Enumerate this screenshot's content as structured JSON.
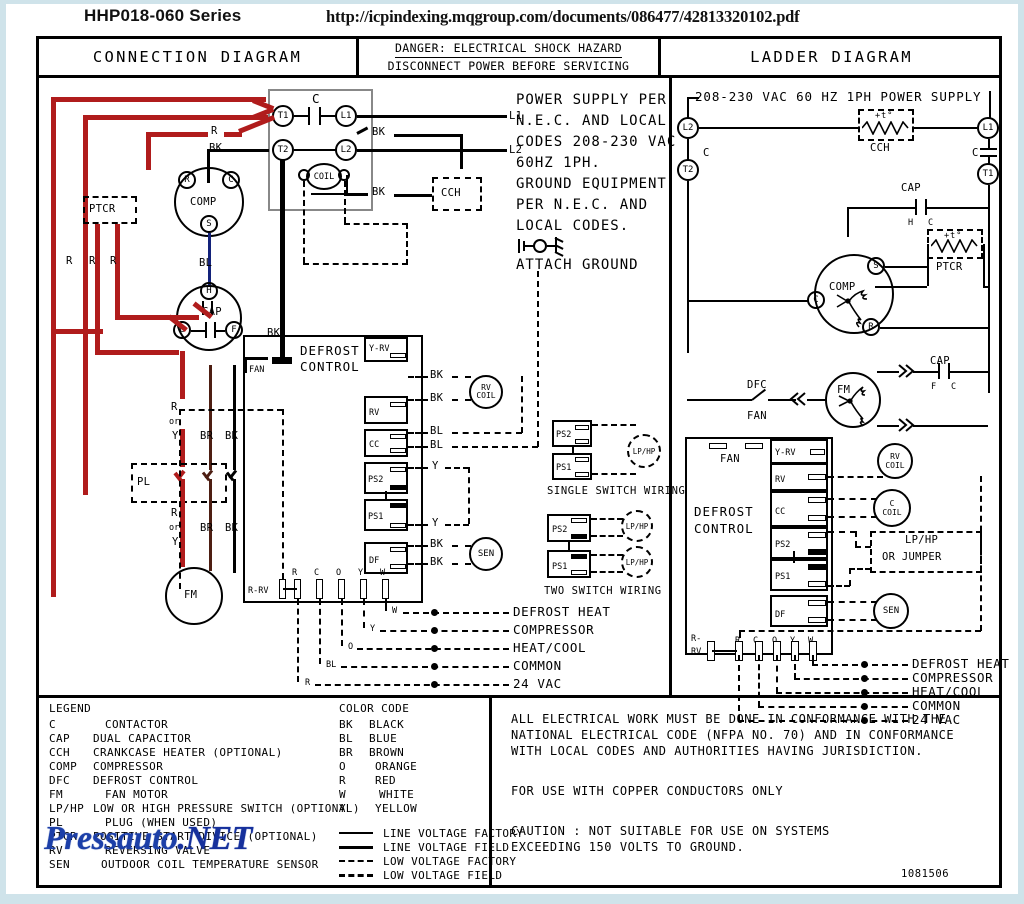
{
  "header": {
    "series": "HHP018-060 Series",
    "url": "http://icpindexing.mqgroup.com/documents/086477/42813320102.pdf"
  },
  "titles": {
    "connection": "CONNECTION    DIAGRAM",
    "danger_line1": "DANGER: ELECTRICAL  SHOCK  HAZARD",
    "danger_line2": "DISCONNECT  POWER  BEFORE  SERVICING",
    "ladder": "LADDER       DIAGRAM"
  },
  "power_note": {
    "lines": [
      "POWER SUPPLY PER",
      "N.E.C. AND LOCAL",
      "CODES 208-230 VAC",
      "60HZ 1PH.",
      "GROUND EQUIPMENT",
      "PER N.E.C. AND",
      "LOCAL CODES."
    ],
    "attach_ground": "ATTACH GROUND",
    "l1": "L1",
    "l2": "L2"
  },
  "connection": {
    "contactor_label": "C",
    "coil_label": "COIL",
    "terminals": {
      "t1": "T1",
      "t2": "T2",
      "l1": "L1",
      "l2": "L2"
    },
    "cch": "CCH",
    "ptcr": "PTCR",
    "comp": "COMP",
    "comp_terms": {
      "r": "R",
      "c": "C",
      "s": "S"
    },
    "cap": "CAP",
    "cap_terms": {
      "h": "H",
      "c": "C",
      "f": "F"
    },
    "fm": "FM",
    "plug": "PL",
    "wire_labels": {
      "r": "R",
      "bk": "BK",
      "bl": "BL",
      "br": "BR",
      "y": "Y",
      "or": "or",
      "w": "W",
      "o": "O"
    },
    "defrost_title_l1": "DEFROST",
    "defrost_title_l2": "CONTROL",
    "fan_label": "FAN",
    "dc_rows": [
      "Y-RV",
      "RV",
      "CC",
      "PS2",
      "PS1",
      "DF"
    ],
    "dc_bottom_terms": [
      "R",
      "C",
      "O",
      "Y",
      "W"
    ],
    "r_rv": "R-RV",
    "rv_coil_l1": "RV",
    "rv_coil_l2": "COIL",
    "sen": "SEN",
    "side_labels": [
      "BK",
      "BK",
      "BL",
      "BL",
      "Y",
      "Y",
      "BK",
      "BK"
    ]
  },
  "switch_wiring": {
    "single_title": "SINGLE SWITCH WIRING",
    "two_title": "TWO SWITCH WIRING",
    "ps2": "PS2",
    "ps1": "PS1",
    "lphp": "LP/HP"
  },
  "field_connections": {
    "rows": [
      {
        "wire": "W",
        "name": "DEFROST HEAT"
      },
      {
        "wire": "Y",
        "name": "COMPRESSOR"
      },
      {
        "wire": "O",
        "name": "HEAT/COOL"
      },
      {
        "wire": "BL",
        "name": "COMMON"
      },
      {
        "wire": "R",
        "name": "24 VAC"
      }
    ]
  },
  "ladder": {
    "supply": "208-230 VAC 60 HZ 1PH POWER SUPPLY",
    "terminals": {
      "l1": "L1",
      "l2": "L2",
      "t1": "T1",
      "t2": "T2"
    },
    "contactor_label": "C",
    "cch": "CCH",
    "ptcr": "PTCR",
    "cap": "CAP",
    "cap_terms_top": {
      "h": "H",
      "c": "C"
    },
    "cap_terms_bottom": {
      "f": "F",
      "c": "C"
    },
    "comp": "COMP",
    "comp_terms": {
      "s": "S",
      "c": "C",
      "r": "R"
    },
    "dfc": "DFC",
    "dfc_sub": "FAN",
    "fm": "FM",
    "defrost_title_l1": "DEFROST",
    "defrost_title_l2": "CONTROL",
    "fan_label": "FAN",
    "dc_rows": [
      "Y-RV",
      "RV",
      "CC",
      "PS2",
      "PS1",
      "DF"
    ],
    "dc_bottom_terms": [
      "R",
      "C",
      "O",
      "Y",
      "W"
    ],
    "r_rv_l1": "R-",
    "r_rv_l2": "RV",
    "rv_coil_l1": "RV",
    "rv_coil_l2": "COIL",
    "c_coil_l1": "C",
    "c_coil_l2": "COIL",
    "lphp_l1": "LP/HP",
    "lphp_l2": "OR JUMPER",
    "sen": "SEN",
    "field_rows": [
      "DEFROST HEAT",
      "COMPRESSOR",
      "HEAT/COOL",
      "COMMON",
      "24 VAC"
    ]
  },
  "legend": {
    "title": "LEGEND",
    "items": [
      {
        "key": "C",
        "val": "CONTACTOR"
      },
      {
        "key": "CAP",
        "val": "DUAL CAPACITOR"
      },
      {
        "key": "CCH",
        "val": "CRANKCASE HEATER (OPTIONAL)"
      },
      {
        "key": "COMP",
        "val": "COMPRESSOR"
      },
      {
        "key": "DFC",
        "val": "DEFROST CONTROL"
      },
      {
        "key": "FM",
        "val": "FAN MOTOR"
      },
      {
        "key": "LP/HP",
        "val": "LOW OR HIGH PRESSURE SWITCH (OPTIONAL)"
      },
      {
        "key": "PL",
        "val": "PLUG (WHEN USED)"
      },
      {
        "key": "PTCR",
        "val": "POSITIVE START DIVICE (OPTIONAL)"
      },
      {
        "key": "RV",
        "val": "REVERSING VALVE"
      },
      {
        "key": "SEN",
        "val": "OUTDOOR COIL TEMPERATURE SENSOR"
      }
    ],
    "color_title": "COLOR CODE",
    "colors": [
      {
        "key": "BK",
        "val": "BLACK"
      },
      {
        "key": "BL",
        "val": "BLUE"
      },
      {
        "key": "BR",
        "val": "BROWN"
      },
      {
        "key": "O",
        "val": "ORANGE"
      },
      {
        "key": "R",
        "val": "RED"
      },
      {
        "key": "W",
        "val": "WHITE"
      },
      {
        "key": "Y",
        "val": "YELLOW"
      }
    ],
    "line_types": [
      "LINE VOLTAGE FACTORY",
      "LINE VOLTAGE FIELD",
      "LOW VOLTAGE FACTORY",
      "LOW VOLTAGE FIELD"
    ]
  },
  "notes": {
    "para1": [
      "ALL ELECTRICAL WORK MUST BE DONE IN CONFORMANCE WITH THE",
      "NATIONAL ELECTRICAL CODE (NFPA NO. 70) AND IN CONFORMANCE",
      "WITH LOCAL CODES AND AUTHORITIES HAVING JURISDICTION."
    ],
    "para2": [
      "FOR USE WITH COPPER CONDUCTORS ONLY"
    ],
    "para3": [
      "CAUTION : NOT SUITABLE FOR USE ON SYSTEMS",
      "EXCEEDING 150 VOLTS TO GROUND."
    ],
    "doc_number": "1081506"
  },
  "watermark": {
    "text1": "Pressauto",
    "text2": ".NET"
  },
  "colors": {
    "red_wire": "#b01c1c",
    "black_wire": "#000000",
    "blue_wire": "#13227a",
    "brown_wire": "#4d1e12",
    "page_bg": "#cfe3ea",
    "watermark": "#1c3fa8"
  }
}
